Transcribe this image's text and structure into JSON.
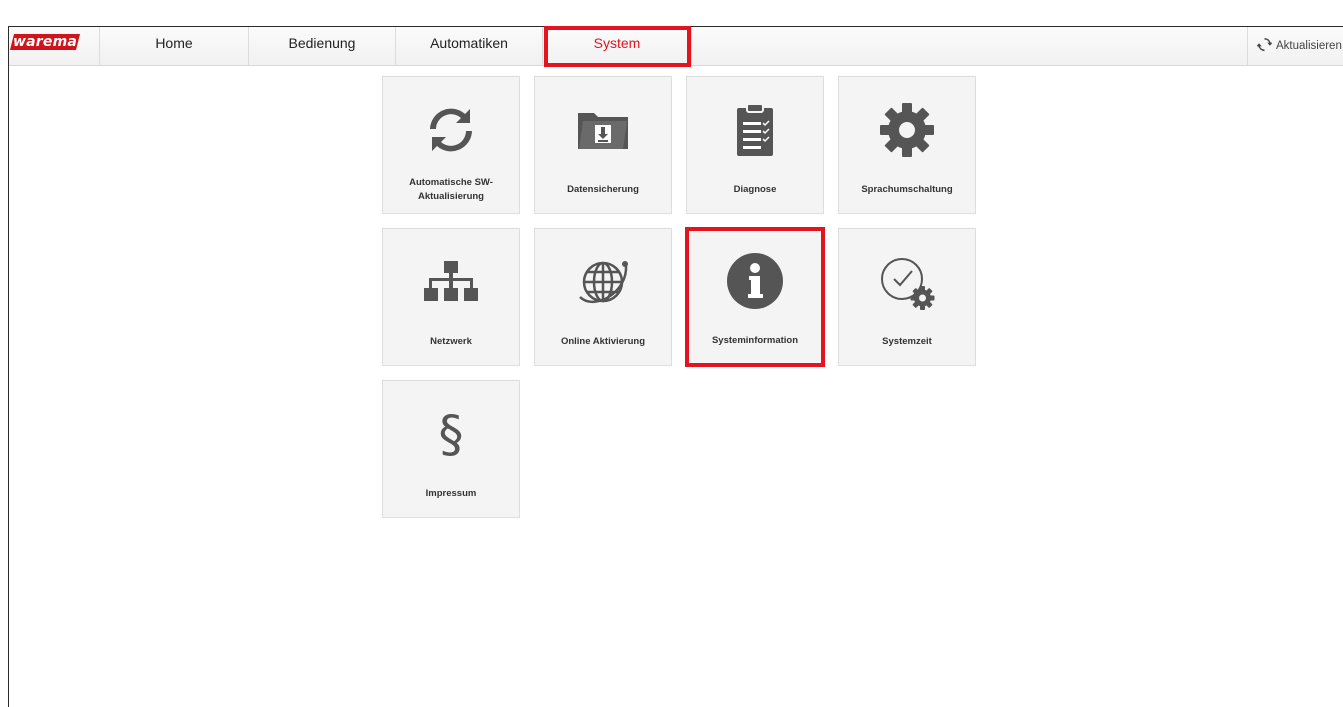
{
  "brand": {
    "logo_text": "warema",
    "accent_color": "#e3141f",
    "logo_color": "#d0141c"
  },
  "nav": {
    "items": [
      {
        "label": "Home"
      },
      {
        "label": "Bedienung"
      },
      {
        "label": "Automatiken"
      },
      {
        "label": "System",
        "active": true
      }
    ],
    "refresh_label": "Aktualisieren"
  },
  "tiles": [
    {
      "label": "Automatische SW-Aktualisierung",
      "icon": "sync-icon"
    },
    {
      "label": "Datensicherung",
      "icon": "folder-download-icon"
    },
    {
      "label": "Diagnose",
      "icon": "clipboard-icon"
    },
    {
      "label": "Sprachumschaltung",
      "icon": "gear-icon"
    },
    {
      "label": "Netzwerk",
      "icon": "network-icon"
    },
    {
      "label": "Online Aktivierung",
      "icon": "globe-icon"
    },
    {
      "label": "Systeminformation",
      "icon": "info-icon",
      "highlighted": true
    },
    {
      "label": "Systemzeit",
      "icon": "clock-gear-icon"
    },
    {
      "label": "Impressum",
      "icon": "section-sign-icon",
      "glyph": "§"
    }
  ]
}
